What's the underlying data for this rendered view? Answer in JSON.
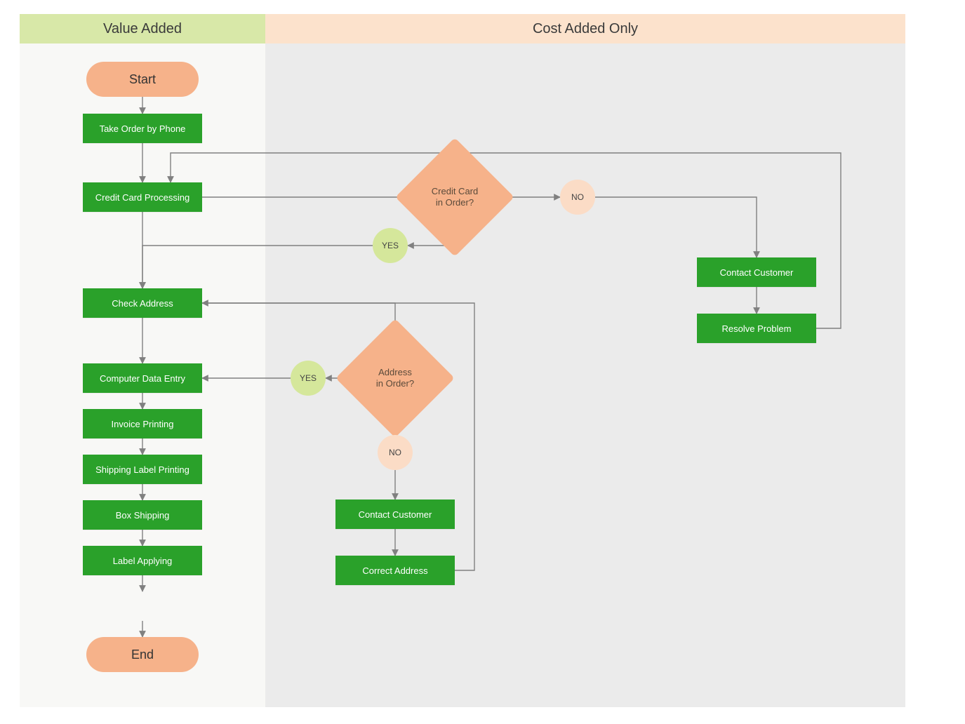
{
  "headers": {
    "left": "Value Added",
    "right": "Cost Added Only"
  },
  "nodes": {
    "start": "Start",
    "end": "End",
    "takeOrder": "Take Order by Phone",
    "ccProcessing": "Credit Card Processing",
    "checkAddress": "Check Address",
    "dataEntry": "Computer Data Entry",
    "invoice": "Invoice Printing",
    "shipLabel": "Shipping Label Printing",
    "boxShip": "Box Shipping",
    "labelApply": "Label Applying",
    "contactCust1": "Contact Customer",
    "resolveProblem": "Resolve Problem",
    "contactCust2": "Contact Customer",
    "correctAddress": "Correct Address"
  },
  "decisions": {
    "ccInOrder": "Credit Card\nin Order?",
    "addrInOrder": "Address\nin Order?"
  },
  "labels": {
    "yes": "YES",
    "no": "NO"
  }
}
